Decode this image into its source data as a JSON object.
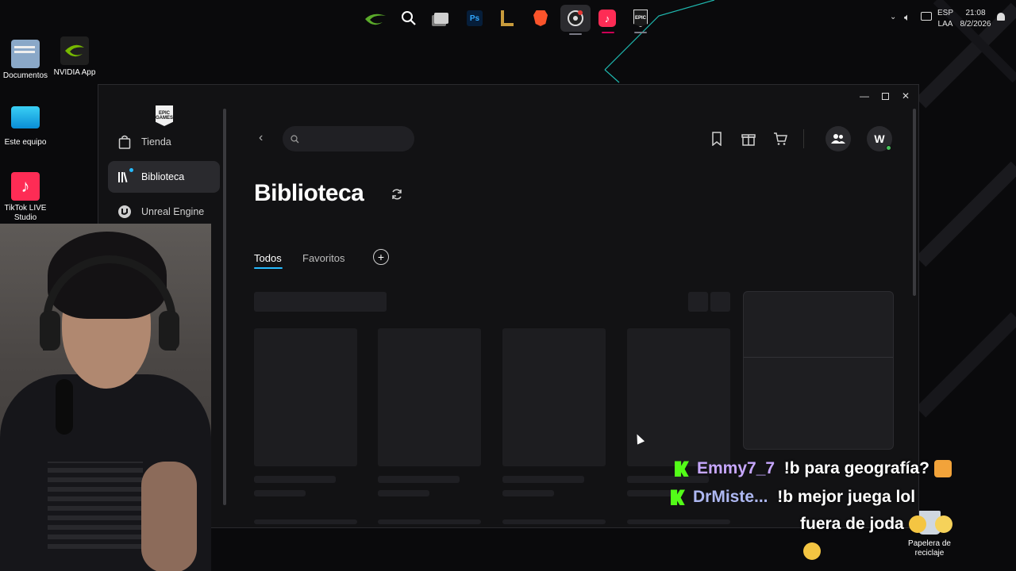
{
  "desktop": {
    "icons": [
      {
        "label": "Documentos"
      },
      {
        "label": "NVIDIA App"
      },
      {
        "label": "Este equipo"
      },
      {
        "label": "TikTok LIVE Studio"
      },
      {
        "label": "Papelera de reciclaje"
      }
    ]
  },
  "taskbar": {
    "apps": [
      {
        "icon": "nvidia-icon"
      },
      {
        "icon": "search-icon"
      },
      {
        "icon": "task-view-icon"
      },
      {
        "icon": "photoshop-icon",
        "text": "Ps"
      },
      {
        "icon": "league-of-legends-icon"
      },
      {
        "icon": "brave-icon"
      },
      {
        "icon": "obs-icon"
      },
      {
        "icon": "tiktok-icon"
      },
      {
        "icon": "epic-games-icon",
        "text": "EPIC"
      }
    ],
    "tray": {
      "lang_top": "ESP",
      "lang_bottom": "LAA",
      "time": "21:08",
      "date": "8/2/2026"
    }
  },
  "window": {
    "sidebar": {
      "logo_text": "EPIC GAMES",
      "items": [
        {
          "label": "Tienda",
          "icon": "bag-icon"
        },
        {
          "label": "Biblioteca",
          "icon": "library-icon"
        },
        {
          "label": "Unreal Engine",
          "icon": "unreal-icon"
        }
      ]
    },
    "header": {
      "search_placeholder": ""
    },
    "title": "Biblioteca",
    "tabs": [
      {
        "label": "Todos"
      },
      {
        "label": "Favoritos"
      }
    ],
    "avatar_initial": "W"
  },
  "chat": [
    {
      "user": "Emmy7_7",
      "message": "!b para geografía?"
    },
    {
      "user": "DrMiste...",
      "message": "!b mejor juega lol",
      "message2": "fuera de joda"
    }
  ],
  "colors": {
    "accent": "#26bbff",
    "kick_green": "#53fc18",
    "online": "#46c35a"
  }
}
